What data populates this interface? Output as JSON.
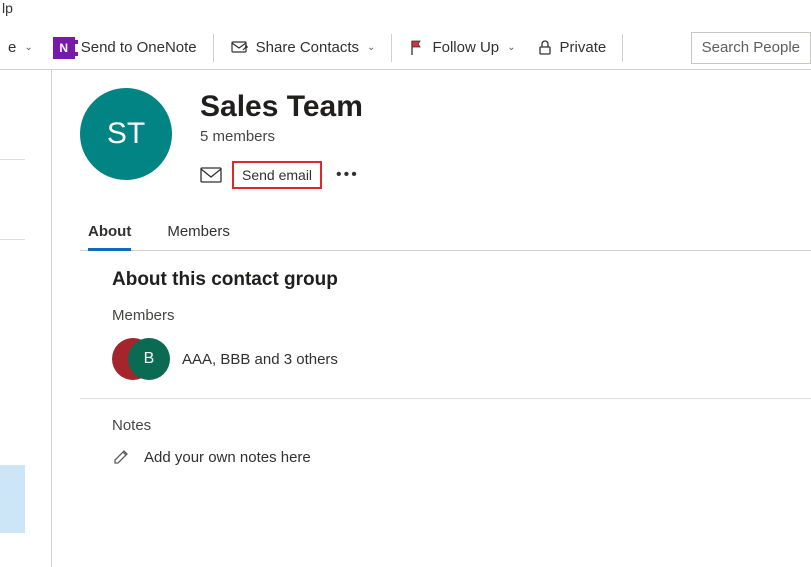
{
  "topbar_fragment": "lp",
  "ribbon": {
    "frag_e_label": "e",
    "onenote_label": "Send to OneNote",
    "share_label": "Share Contacts",
    "followup_label": "Follow Up",
    "private_label": "Private",
    "search_placeholder": "Search People"
  },
  "group": {
    "initials": "ST",
    "title": "Sales Team",
    "member_count_text": "5 members",
    "send_email_label": "Send email"
  },
  "tabs": {
    "about": "About",
    "members": "Members"
  },
  "about_panel": {
    "title": "About this contact group",
    "members_label": "Members",
    "member_avatar2_initial": "B",
    "members_text": "AAA, BBB and 3 others"
  },
  "notes_panel": {
    "label": "Notes",
    "placeholder": "Add your own notes here"
  }
}
